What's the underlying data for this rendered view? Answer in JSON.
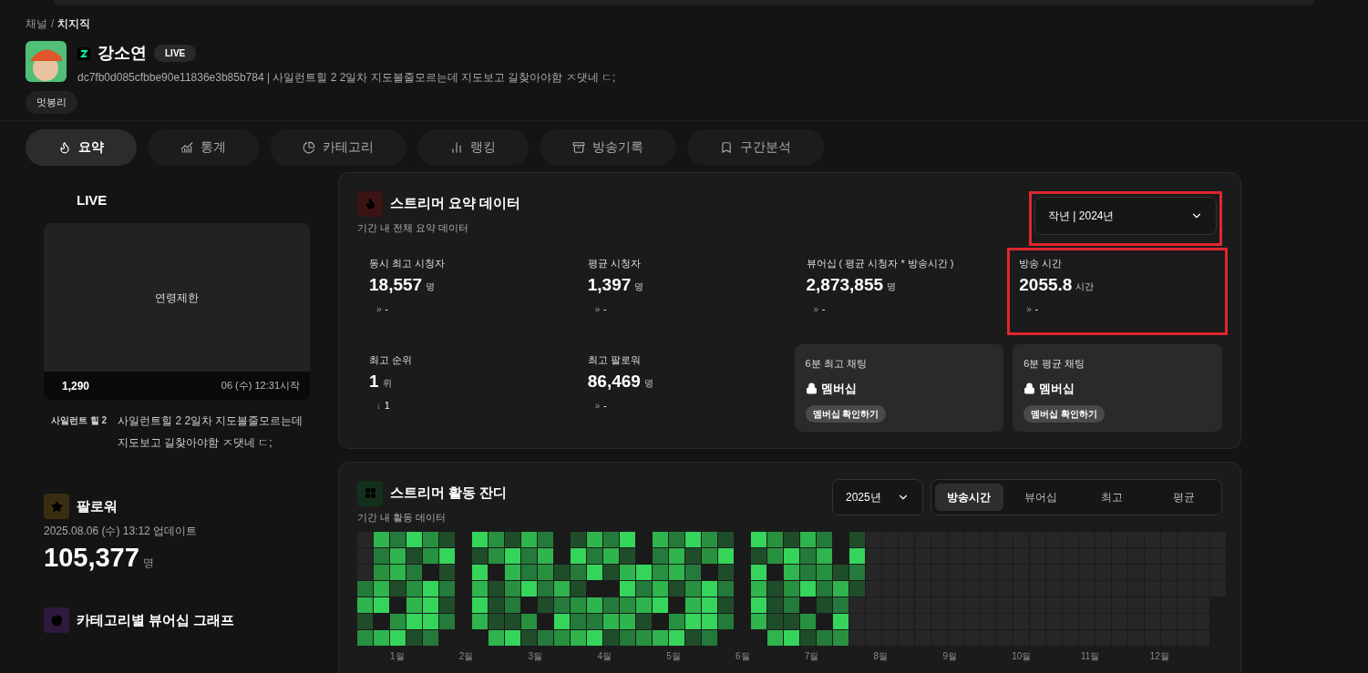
{
  "breadcrumb": [
    "채널",
    "치지직"
  ],
  "breadcrumb_separator": "/",
  "channel": {
    "name": "강소연",
    "badge": "LIVE",
    "description": "dc7fb0d085cfbbe90e11836e3b85b784 | 사일런트힐 2 2일차 지도볼줄모르는데 지도보고 길찾아야함 ㅈ댓네 ㄷ;",
    "tags": [
      "멋봉리"
    ]
  },
  "tabs": [
    {
      "label": "요약",
      "kind": "flame",
      "selected": true
    },
    {
      "label": "통계",
      "kind": "chart",
      "selected": false
    },
    {
      "label": "카테고리",
      "kind": "pie",
      "selected": false
    },
    {
      "label": "랭킹",
      "kind": "bars",
      "selected": false
    },
    {
      "label": "방송기록",
      "kind": "archive",
      "selected": false
    },
    {
      "label": "구간분석",
      "kind": "bookmark",
      "selected": false
    }
  ],
  "live": {
    "heading": "LIVE",
    "notice": "연령제한",
    "viewers": "1,290",
    "started": "06 (수) 12:31시작",
    "category": "사일런트 힐 2",
    "title": "사일런트힐 2 2일차 지도볼줄모르는데 지도보고 길찾아야함 ㅈ댓네 ㄷ;"
  },
  "followers": {
    "title": "팔로워",
    "updated": "2025.08.06 (수) 13:12 업데이트",
    "value": "105,377",
    "unit": "명"
  },
  "category_graph": {
    "title": "카테고리별 뷰어십 그래프"
  },
  "summary": {
    "title": "스트리머 요약 데이터",
    "subtitle": "기간 내 전체 요약 데이터",
    "period": {
      "value": "작년 | 2024년",
      "highlighted": true
    },
    "stats": [
      {
        "kind": "stat",
        "label": "동시 최고 시청자",
        "value": "18,557",
        "unit": "명",
        "arrow": "»",
        "change": "-",
        "highlighted": false
      },
      {
        "kind": "stat",
        "label": "평균 시청자",
        "value": "1,397",
        "unit": "명",
        "arrow": "»",
        "change": "-",
        "highlighted": false
      },
      {
        "kind": "stat",
        "label": "뷰어십 ( 평균 시청자 * 방송시간 )",
        "value": "2,873,855",
        "unit": "명",
        "arrow": "»",
        "change": "-",
        "highlighted": false
      },
      {
        "kind": "stat",
        "label": "방송 시간",
        "value": "2055.8",
        "unit": "시간",
        "arrow": "»",
        "change": "-",
        "highlighted": true
      },
      {
        "kind": "stat",
        "label": "최고 순위",
        "value": "1",
        "unit": "위",
        "arrow": "↓",
        "change": "1",
        "highlighted": false
      },
      {
        "kind": "stat",
        "label": "최고 팔로워",
        "value": "86,469",
        "unit": "명",
        "arrow": "»",
        "change": "-",
        "highlighted": false
      },
      {
        "kind": "locked",
        "label": "6분 최고 채팅",
        "value": "멤버십",
        "button": "멤버십 확인하기"
      },
      {
        "kind": "locked",
        "label": "6분 평균 채팅",
        "value": "멤버십",
        "button": "멤버십 확인하기"
      }
    ]
  },
  "activity": {
    "title": "스트리머 활동 잔디",
    "subtitle": "기간 내 활동 데이터",
    "year": "2025년",
    "modes": [
      {
        "label": "방송시간",
        "selected": true
      },
      {
        "label": "뷰어십",
        "selected": false
      },
      {
        "label": "최고",
        "selected": false
      },
      {
        "label": "평균",
        "selected": false
      }
    ],
    "months": [
      "1월",
      "2월",
      "3월",
      "4월",
      "5월",
      "6월",
      "7월",
      "8월",
      "9월",
      "10월",
      "11월",
      "12월"
    ]
  }
}
